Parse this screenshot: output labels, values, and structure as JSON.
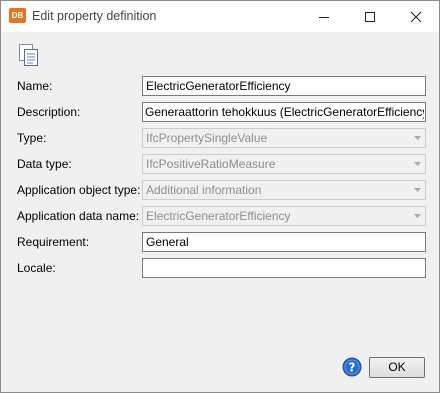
{
  "titlebar": {
    "app_badge": "DB",
    "title": "Edit property definition",
    "icons": [
      "minimize-icon",
      "maximize-icon",
      "close-icon"
    ]
  },
  "form": {
    "name": {
      "label": "Name:",
      "value": "ElectricGeneratorEfficiency"
    },
    "description": {
      "label": "Description:",
      "value": "Generaattorin tehokkuus (ElectricGeneratorEfficiency)"
    },
    "type": {
      "label": "Type:",
      "value": "IfcPropertySingleValue"
    },
    "data_type": {
      "label": "Data type:",
      "value": "IfcPositiveRatioMeasure"
    },
    "application_object_type": {
      "label": "Application object type:",
      "value": "Additional information"
    },
    "application_data_name": {
      "label": "Application data name:",
      "value": "ElectricGeneratorEfficiency"
    },
    "requirement": {
      "label": "Requirement:",
      "value": "General"
    },
    "locale": {
      "label": "Locale:",
      "value": ""
    }
  },
  "footer": {
    "help_icon": "help-icon",
    "ok_label": "OK"
  },
  "colors": {
    "accent": "#e8741d",
    "help_blue": "#2a6bc6",
    "disabled_text": "#8e8e8e"
  }
}
